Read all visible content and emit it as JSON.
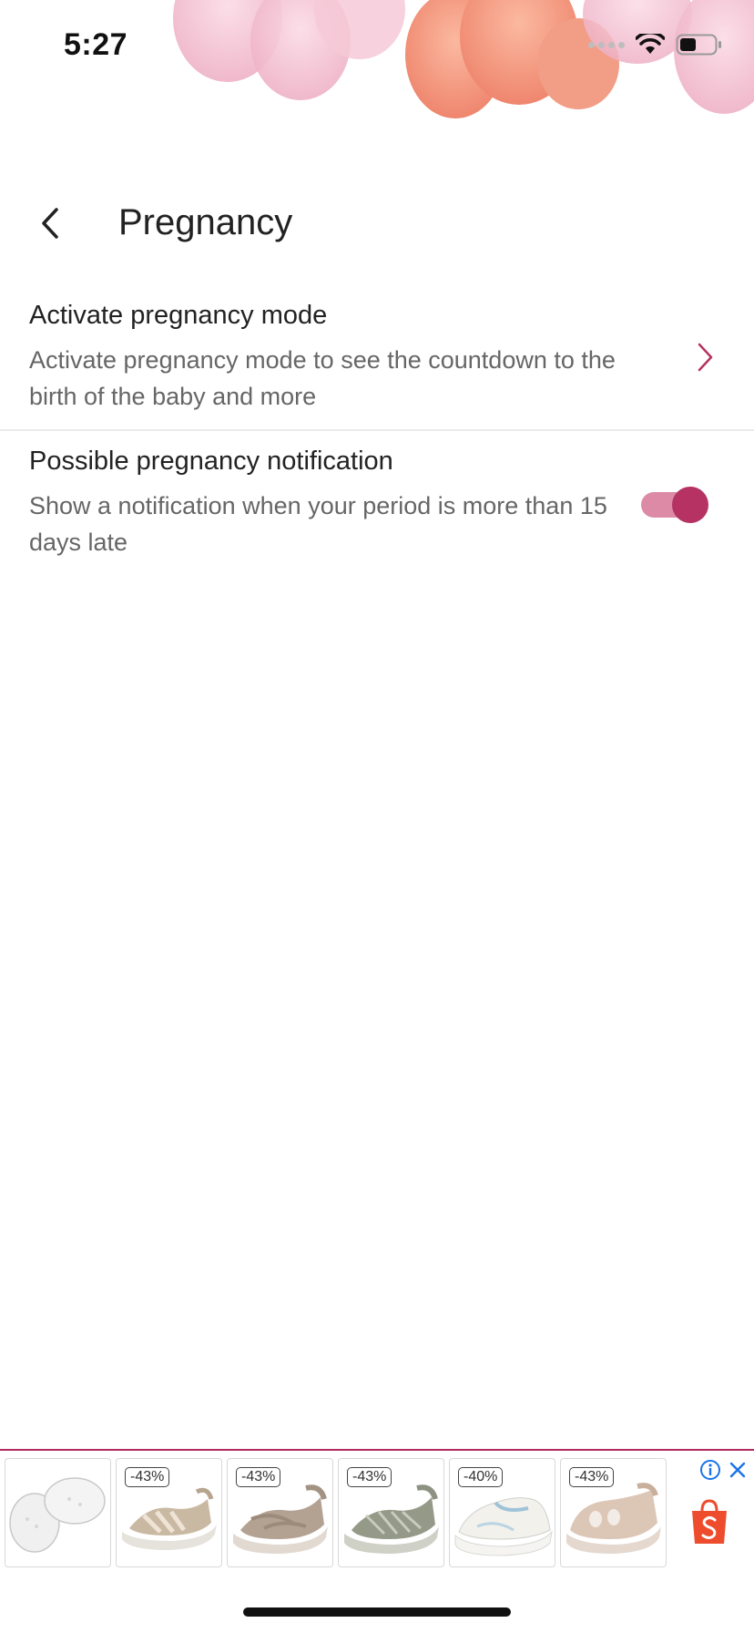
{
  "status_bar": {
    "time": "5:27"
  },
  "header": {
    "title": "Pregnancy"
  },
  "settings": [
    {
      "title": "Activate pregnancy mode",
      "description": "Activate pregnancy mode to see the countdown to the birth of the baby and more",
      "control": "chevron-right-icon"
    },
    {
      "title": "Possible pregnancy notification",
      "description": "Show a notification when your period is more than 15 days late",
      "control": "toggle",
      "toggle_on": true
    }
  ],
  "ad": {
    "discounts": [
      "-43%",
      "-43%",
      "-43%",
      "-40%",
      "-43%"
    ],
    "products": [
      "gel-insoles",
      "sandal",
      "sandal",
      "sandal",
      "sneaker",
      "closed-toe-sandal"
    ],
    "info_icon": "info-icon",
    "close_icon": "close-icon",
    "shop_icon": "shopping-bag-icon"
  },
  "colors": {
    "accent": "#b53262",
    "toggle_track": "#dc8aa6",
    "chevron": "#b53262",
    "ad_border": "#b02a5e",
    "shop_orange": "#ee4d2d"
  }
}
